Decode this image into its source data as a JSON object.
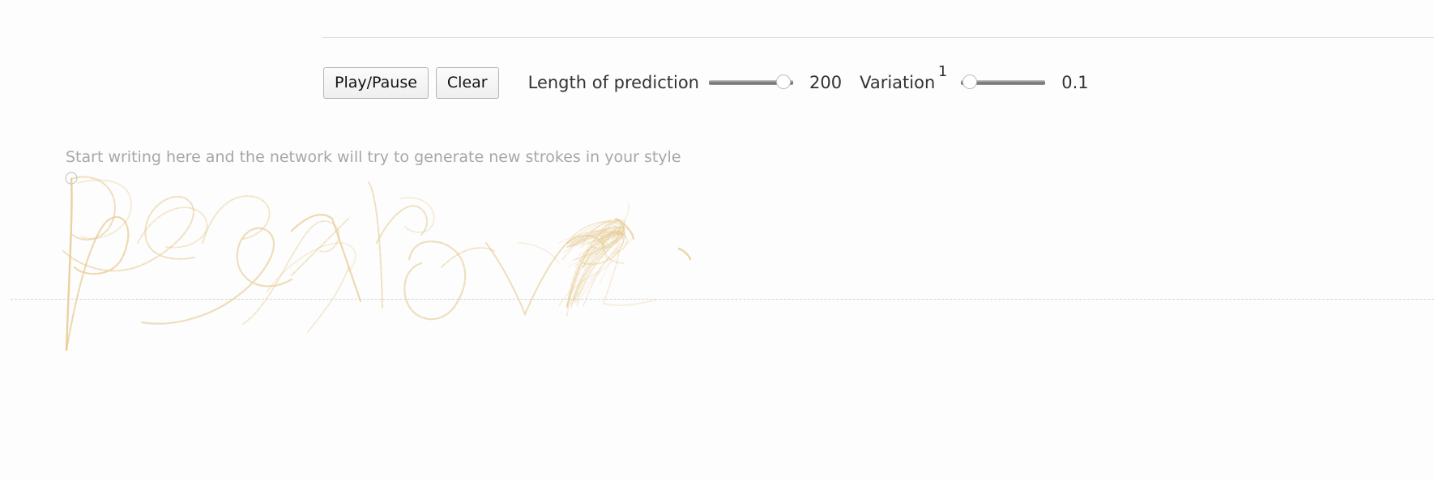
{
  "toolbar": {
    "play_pause_label": "Play/Pause",
    "clear_label": "Clear",
    "length_label": "Length of prediction",
    "length_value": "200",
    "length_fraction": 0.88,
    "variation_label": "Variation",
    "variation_superscript": "1",
    "variation_value": "0.1",
    "variation_fraction": 0.1
  },
  "canvas": {
    "hint": "Start writing here and the network will try to generate new strokes in your style",
    "stroke_color": "#e6c98f"
  }
}
